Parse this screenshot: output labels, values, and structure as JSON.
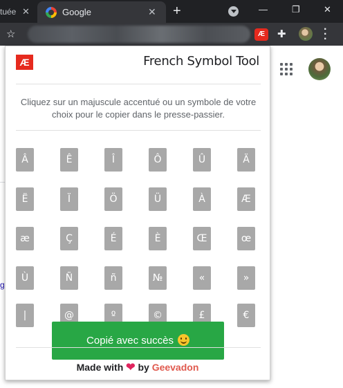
{
  "browser": {
    "tabs": [
      {
        "label": "tuée",
        "active": false
      },
      {
        "label": "Google",
        "active": true
      }
    ],
    "new_tab": "+",
    "close_glyph": "✕",
    "window_controls": [
      "—",
      "❐",
      "✕"
    ],
    "extension_badge": "Æ"
  },
  "popup": {
    "logo_text": "Æ",
    "title": "French Symbol Tool",
    "description": "Cliquez sur un majuscule accentué ou un symbole de votre choix pour le copier dans le presse-passier.",
    "symbols": [
      [
        "Â",
        "Ê",
        "Î",
        "Ô",
        "Û",
        "Ä"
      ],
      [
        "Ë",
        "Ï",
        "Ö",
        "Ü",
        "À",
        "Æ"
      ],
      [
        "æ",
        "Ç",
        "É",
        "È",
        "Œ",
        "œ"
      ],
      [
        "Ù",
        "Ñ",
        "ñ",
        "№",
        "«",
        "»"
      ],
      [
        "|",
        "@",
        "º",
        "©",
        "£",
        "€"
      ]
    ],
    "toast": "Copié avec succès",
    "footer": {
      "made_with": "Made with",
      "by": "by",
      "author": "Geevadon"
    }
  },
  "colors": {
    "brand_red": "#e62a1e",
    "toast_green": "#28a745",
    "symbol_button": "#a8a8a8",
    "heart": "#e0245e",
    "author": "#e05a4e"
  }
}
